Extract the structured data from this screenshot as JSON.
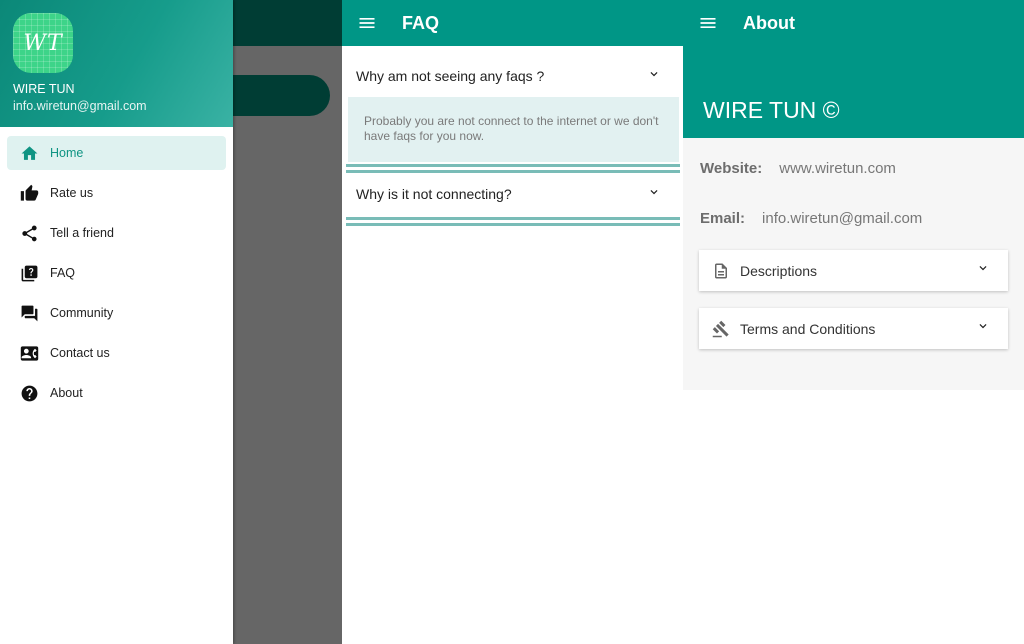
{
  "colors": {
    "primary": "#009686",
    "primary_dark": "#003d34",
    "active_bg": "#dff2f0",
    "faq_answer_bg": "#e2f1f1",
    "faq_divider": "#79bcb7",
    "scrim": "#666666"
  },
  "drawer": {
    "logo_text": "WT",
    "app_name": "WIRE TUN",
    "email": "info.wiretun@gmail.com",
    "items": [
      {
        "label": "Home",
        "icon": "home-icon",
        "active": true
      },
      {
        "label": "Rate us",
        "icon": "thumb-up-icon",
        "active": false
      },
      {
        "label": "Tell a friend",
        "icon": "share-icon",
        "active": false
      },
      {
        "label": "FAQ",
        "icon": "faq-icon",
        "active": false
      },
      {
        "label": "Community",
        "icon": "forum-icon",
        "active": false
      },
      {
        "label": "Contact us",
        "icon": "contact-card-icon",
        "active": false
      },
      {
        "label": "About",
        "icon": "help-circle-icon",
        "active": false
      }
    ]
  },
  "faq": {
    "title": "FAQ",
    "items": [
      {
        "question": "Why am not seeing any faqs ?",
        "answer": "Probably you are not connect to the internet or we don't have faqs for you now.",
        "expanded": true
      },
      {
        "question": "Why is it not connecting?",
        "expanded": false
      }
    ]
  },
  "about": {
    "title": "About",
    "brand": "WIRE TUN ©",
    "website_label": "Website:",
    "website_value": "www.wiretun.com",
    "email_label": "Email:",
    "email_value": "info.wiretun@gmail.com",
    "sections": [
      {
        "label": "Descriptions",
        "icon": "document-icon"
      },
      {
        "label": "Terms and Conditions",
        "icon": "gavel-icon"
      }
    ]
  }
}
